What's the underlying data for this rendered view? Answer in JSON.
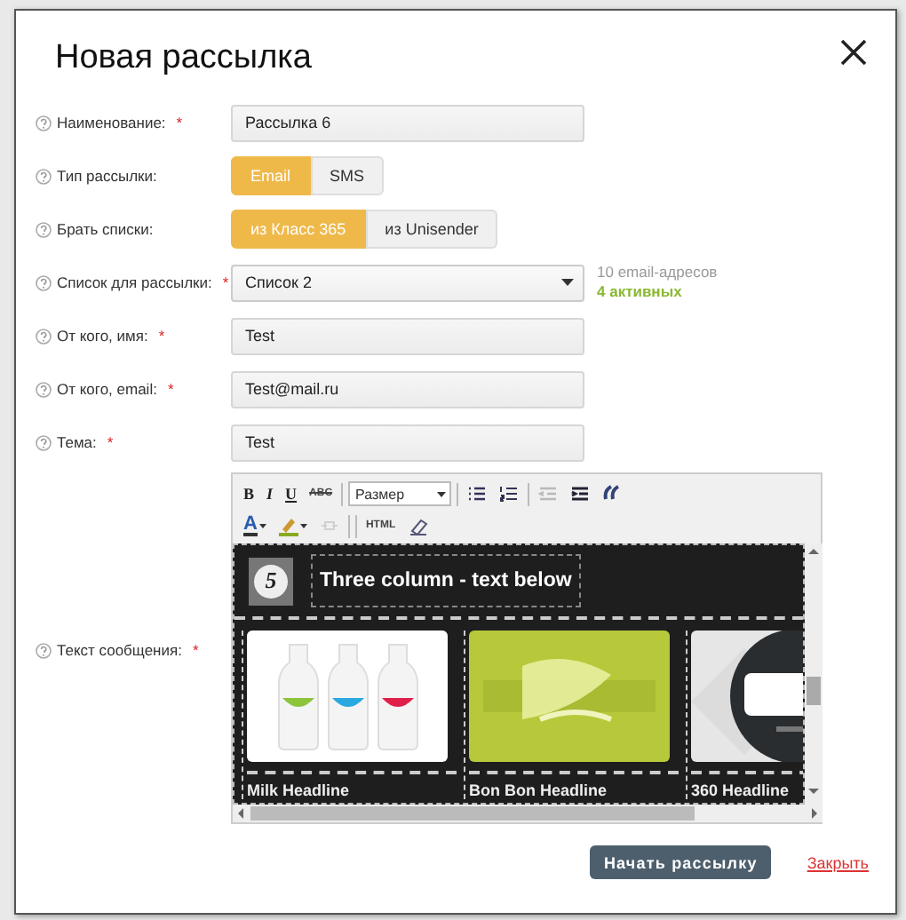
{
  "dialog": {
    "title": "Новая рассылка"
  },
  "fields": [
    {
      "kind": "text",
      "label": "Наименование:",
      "mark": "*",
      "value": "Рассылка 6"
    },
    {
      "kind": "toggle",
      "label": "Тип рассылки:",
      "options": [
        {
          "label": "Email",
          "selected": true
        },
        {
          "label": "SMS",
          "selected": false
        }
      ]
    },
    {
      "kind": "toggle",
      "label": "Брать списки:",
      "options": [
        {
          "label": "из Класс 365",
          "selected": true
        },
        {
          "label": "из Unisender",
          "selected": false
        }
      ]
    },
    {
      "kind": "select",
      "label": "Список для рассылки:",
      "mark": "*",
      "value": "Список 2",
      "info": "10 email-адресов",
      "info_active": "4 активных"
    },
    {
      "kind": "text",
      "label": "От кого, имя:",
      "mark": "*",
      "value": "Test"
    },
    {
      "kind": "text",
      "label": "От кого, email:",
      "mark": "*",
      "value": "Test@mail.ru"
    },
    {
      "kind": "text",
      "label": "Тема:",
      "mark": "*",
      "value": "Test"
    },
    {
      "kind": "editor",
      "label": "Текст сообщения:",
      "mark": "*"
    }
  ],
  "editor": {
    "toolbar_rows": [
      [
        {
          "kind": "bold",
          "label": "B"
        },
        {
          "kind": "italic",
          "label": "I"
        },
        {
          "kind": "underline",
          "label": "U"
        },
        {
          "kind": "strike",
          "label": "ABC"
        },
        {
          "kind": "divider"
        },
        {
          "kind": "size",
          "placeholder": "Размер"
        },
        {
          "kind": "divider"
        },
        {
          "kind": "bullets"
        },
        {
          "kind": "numbers"
        },
        {
          "kind": "divider"
        },
        {
          "kind": "outdent",
          "disabled": true
        },
        {
          "kind": "indent",
          "disabled": false
        },
        {
          "kind": "quote"
        }
      ],
      [
        {
          "kind": "color",
          "label": "A"
        },
        {
          "kind": "highlight"
        },
        {
          "kind": "link",
          "disabled": true
        },
        {
          "kind": "divider"
        },
        {
          "kind": "divider"
        },
        {
          "kind": "html",
          "label": "HTML"
        },
        {
          "kind": "eraser"
        }
      ]
    ],
    "content": {
      "badge": "5",
      "heading": "Three column - text below",
      "columns": [
        {
          "headline": "Milk Headline",
          "kind": "picture"
        },
        {
          "headline": "Bon Bon Headline",
          "kind": "picture"
        },
        {
          "headline": "360 Headline",
          "kind": "picture"
        }
      ]
    }
  },
  "footer": {
    "submit": "Начать рассылку",
    "close": "Закрыть"
  }
}
